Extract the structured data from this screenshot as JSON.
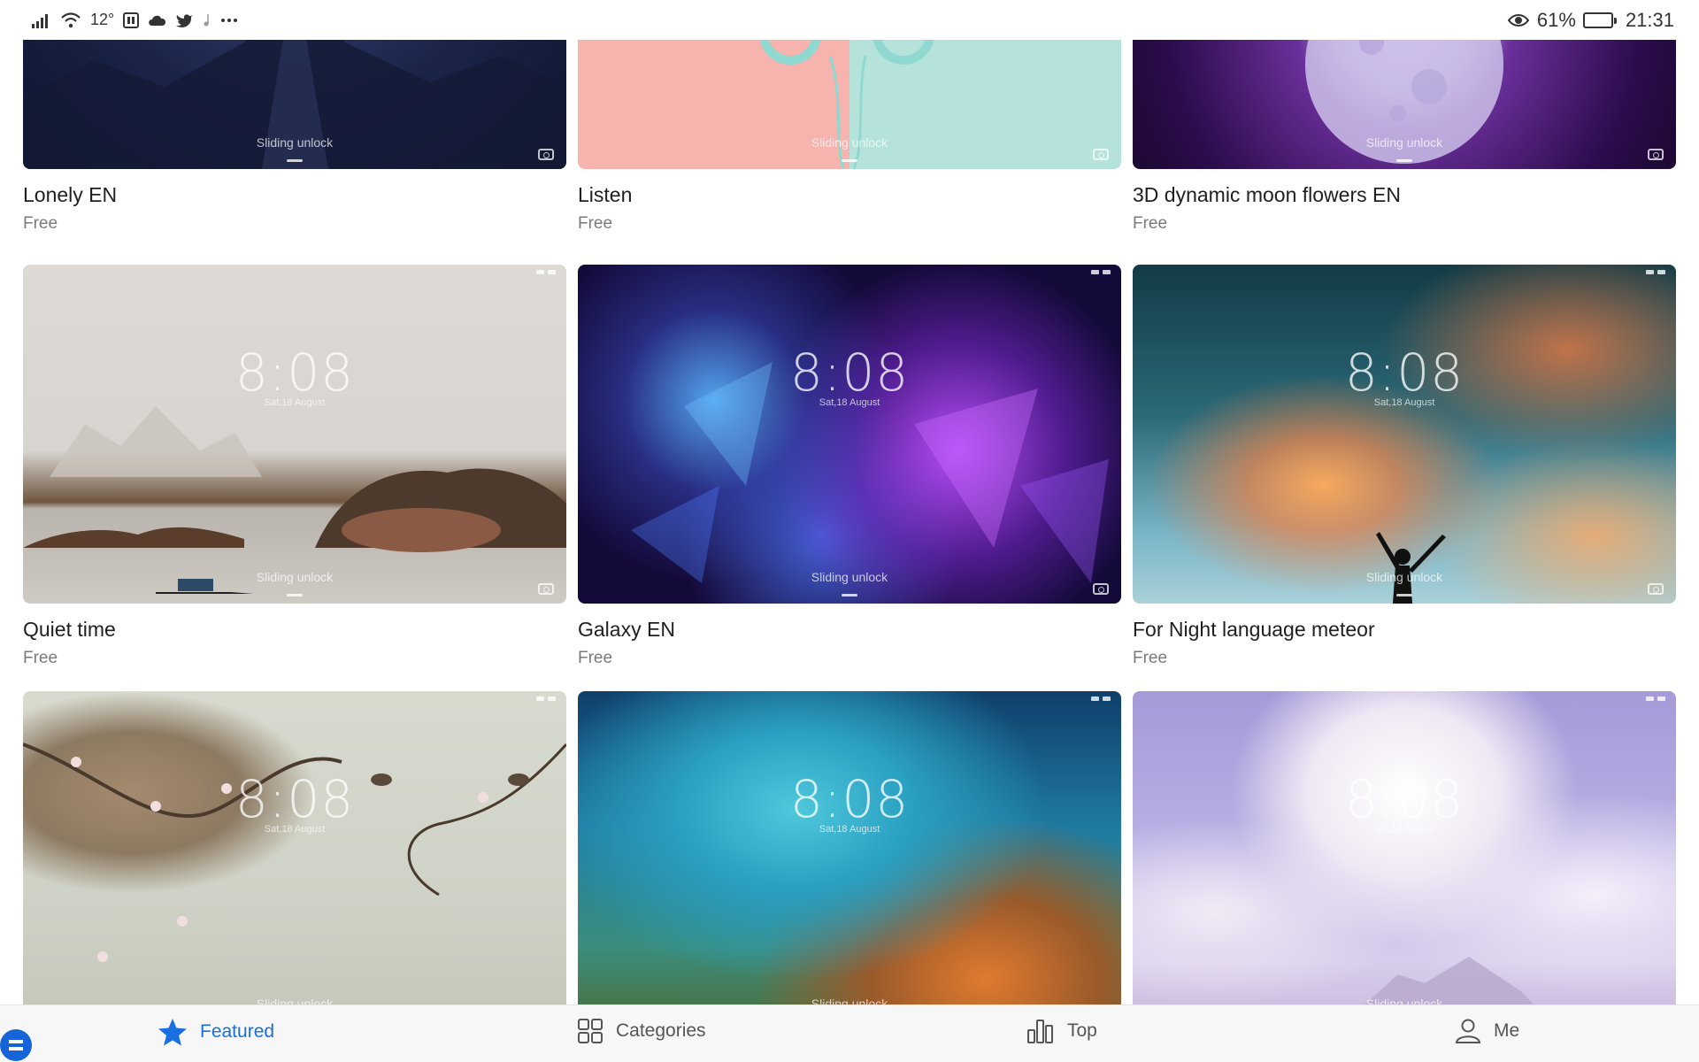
{
  "status_bar": {
    "temperature": "12°",
    "battery_percent": "61%",
    "time": "21:31",
    "icons": [
      "signal-icon",
      "wifi-icon",
      "huawei-app-icon",
      "cloud-icon",
      "twitter-icon",
      "music-note-icon",
      "more-icon",
      "eye-comfort-icon",
      "battery-icon"
    ],
    "battery_level": 0.61
  },
  "lockscreen_preview": {
    "clock": "8:08",
    "date": "Sat,18 August",
    "unlock_hint": "Sliding unlock"
  },
  "themes": [
    {
      "title": "Lonely EN",
      "price": "Free",
      "wallpaper": "dark-blue-mountains",
      "show_clock": false
    },
    {
      "title": "Listen",
      "price": "Free",
      "wallpaper": "pink-mint-headphones",
      "show_clock": false
    },
    {
      "title": "3D dynamic moon flowers EN",
      "price": "Free",
      "wallpaper": "purple-moon",
      "show_clock": false
    },
    {
      "title": "Quiet time",
      "price": "Free",
      "wallpaper": "ink-landscape-boat",
      "show_clock": true
    },
    {
      "title": "Galaxy EN",
      "price": "Free",
      "wallpaper": "purple-galaxy",
      "show_clock": true
    },
    {
      "title": "For Night language meteor",
      "price": "Free",
      "wallpaper": "sunset-clouds-silhouette",
      "show_clock": true
    },
    {
      "title": "",
      "price": "",
      "wallpaper": "plum-blossom-birds",
      "show_clock": true
    },
    {
      "title": "",
      "price": "",
      "wallpaper": "teal-nebula",
      "show_clock": true
    },
    {
      "title": "",
      "price": "",
      "wallpaper": "lavender-clouds",
      "show_clock": true
    }
  ],
  "bottom_nav": {
    "items": [
      {
        "label": "Featured",
        "icon": "star-icon",
        "active": true
      },
      {
        "label": "Categories",
        "icon": "grid-icon",
        "active": false
      },
      {
        "label": "Top",
        "icon": "bar-chart-icon",
        "active": false
      },
      {
        "label": "Me",
        "icon": "person-icon",
        "active": false
      }
    ]
  },
  "colors": {
    "accent": "#1a6fe0",
    "nav_background": "#f7f7f7",
    "title_text": "#1f1f1f",
    "price_text": "#7a7a7a"
  }
}
